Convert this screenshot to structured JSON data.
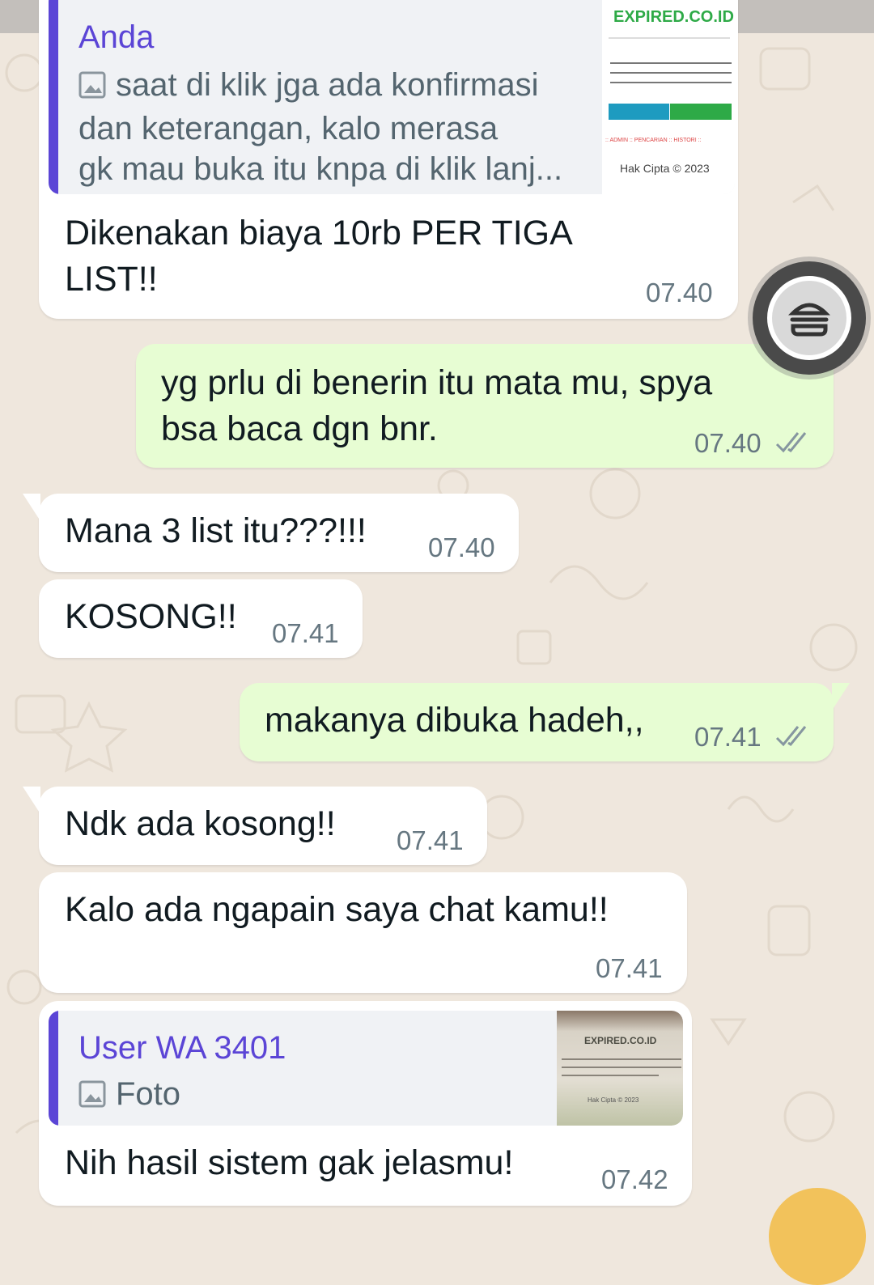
{
  "messages": [
    {
      "id": "m1",
      "direction": "incoming",
      "reply": {
        "author": "Anda",
        "text": "saat di klik jga ada konfirmasi\ndan keterangan, kalo merasa\ngk mau buka itu knpa di klik lanj...",
        "thumb_site": "EXPIRED.CO.ID",
        "thumb_nav": ":: ADMIN :: PENCARIAN :: HISTORI ::",
        "thumb_footer": "Hak Cipta © 2023"
      },
      "text": "Dikenakan biaya 10rb PER TIGA\nLIST!!",
      "time": "07.40"
    },
    {
      "id": "m2",
      "direction": "outgoing",
      "text": "yg prlu di benerin itu mata mu, spya\nbsa baca dgn bnr.",
      "time": "07.40",
      "status": "read"
    },
    {
      "id": "m3",
      "direction": "incoming",
      "text": "Mana 3 list itu???!!!",
      "time": "07.40"
    },
    {
      "id": "m4",
      "direction": "incoming",
      "text": "KOSONG!!",
      "time": "07.41"
    },
    {
      "id": "m5",
      "direction": "outgoing",
      "text": "makanya dibuka hadeh,,",
      "time": "07.41",
      "status": "read"
    },
    {
      "id": "m6",
      "direction": "incoming",
      "text": "Ndk ada kosong!!",
      "time": "07.41"
    },
    {
      "id": "m7",
      "direction": "incoming",
      "text": "Kalo ada ngapain saya chat kamu!!",
      "time": "07.41"
    },
    {
      "id": "m8",
      "direction": "incoming",
      "reply": {
        "author": "User WA 3401",
        "text": "Foto",
        "thumb_site": "EXPIRED.CO.ID",
        "thumb_footer": "Hak Cipta © 2023"
      },
      "text": "Nih hasil sistem gak jelasmu!",
      "time": "07.42"
    }
  ],
  "colors": {
    "background": "#efe7dd",
    "incoming_bubble": "#ffffff",
    "outgoing_bubble": "#e7fdd3",
    "reply_accent": "#5b45d6",
    "read_ticks": "#8696a0"
  },
  "icons": {
    "floating_button": "burger-icon",
    "reply_photo": "image-icon",
    "status": "double-check-icon"
  }
}
